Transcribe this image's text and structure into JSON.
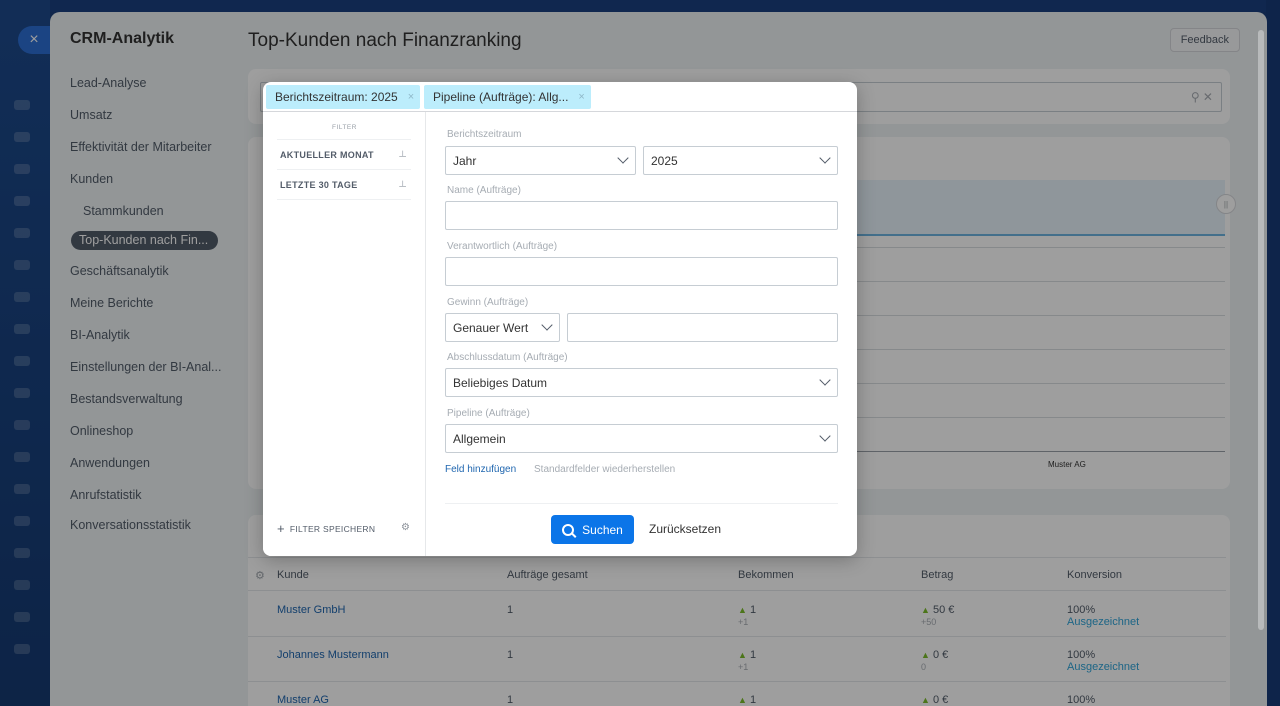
{
  "sidebar": {
    "title": "CRM-Analytik",
    "items": [
      {
        "label": "Lead-Analyse"
      },
      {
        "label": "Umsatz"
      },
      {
        "label": "Effektivität der Mitarbeiter"
      },
      {
        "label": "Kunden"
      },
      {
        "label": "Stammkunden"
      },
      {
        "label": "Top-Kunden nach Fin..."
      },
      {
        "label": "Geschäftsanalytik"
      },
      {
        "label": "Meine Berichte"
      },
      {
        "label": "BI-Analytik"
      },
      {
        "label": "Einstellungen der BI-Anal..."
      },
      {
        "label": "Bestandsverwaltung"
      },
      {
        "label": "Onlineshop"
      },
      {
        "label": "Anwendungen"
      },
      {
        "label": "Anrufstatistik"
      },
      {
        "label": "Konversationsstatistik"
      }
    ]
  },
  "header": {
    "title": "Top-Kunden nach Finanzranking",
    "feedback_label": "Feedback"
  },
  "close_icon": "×",
  "chart": {
    "last_label": "Muster AG"
  },
  "table": {
    "columns": [
      "Kunde",
      "Aufträge gesamt",
      "Bekommen",
      "Betrag",
      "Konversion"
    ],
    "rows": [
      {
        "kunde": "Muster GmbH",
        "auftraege": "1",
        "bekommen": "1",
        "bekommen_diff": "+1",
        "betrag": "50 €",
        "betrag_diff": "+50",
        "konversion": "100%",
        "konversion_label": "Ausgezeichnet"
      },
      {
        "kunde": "Johannes Mustermann",
        "auftraege": "1",
        "bekommen": "1",
        "bekommen_diff": "+1",
        "betrag": "0 €",
        "betrag_diff": "0",
        "konversion": "100%",
        "konversion_label": "Ausgezeichnet"
      },
      {
        "kunde": "Muster AG",
        "auftraege": "1",
        "bekommen": "1",
        "bekommen_diff": "",
        "betrag": "0 €",
        "betrag_diff": "",
        "konversion": "100%",
        "konversion_label": ""
      }
    ]
  },
  "filter_popup": {
    "tags": [
      {
        "label": "Berichtszeitraum: 2025"
      },
      {
        "label": "Pipeline (Aufträge): Allg..."
      }
    ],
    "tag_remove": "×",
    "presets_title": "FILTER",
    "presets": [
      {
        "label": "AKTUELLER MONAT"
      },
      {
        "label": "LETZTE 30 TAGE"
      }
    ],
    "save_filter_label": "FILTER SPEICHERN",
    "fields": {
      "period_label": "Berichtszeitraum",
      "period_type": "Jahr",
      "period_value": "2025",
      "name_label": "Name (Aufträge)",
      "name_value": "",
      "responsible_label": "Verantwortlich (Aufträge)",
      "responsible_value": "",
      "profit_label": "Gewinn (Aufträge)",
      "profit_mode": "Genauer Wert",
      "profit_value": "",
      "close_date_label": "Abschlussdatum (Aufträge)",
      "close_date_value": "Beliebiges Datum",
      "pipeline_label": "Pipeline (Aufträge)",
      "pipeline_value": "Allgemein"
    },
    "add_field_label": "Feld hinzufügen",
    "restore_fields_label": "Standardfelder wiederherstellen",
    "search_button_label": "Suchen",
    "reset_button_label": "Zurücksetzen"
  }
}
